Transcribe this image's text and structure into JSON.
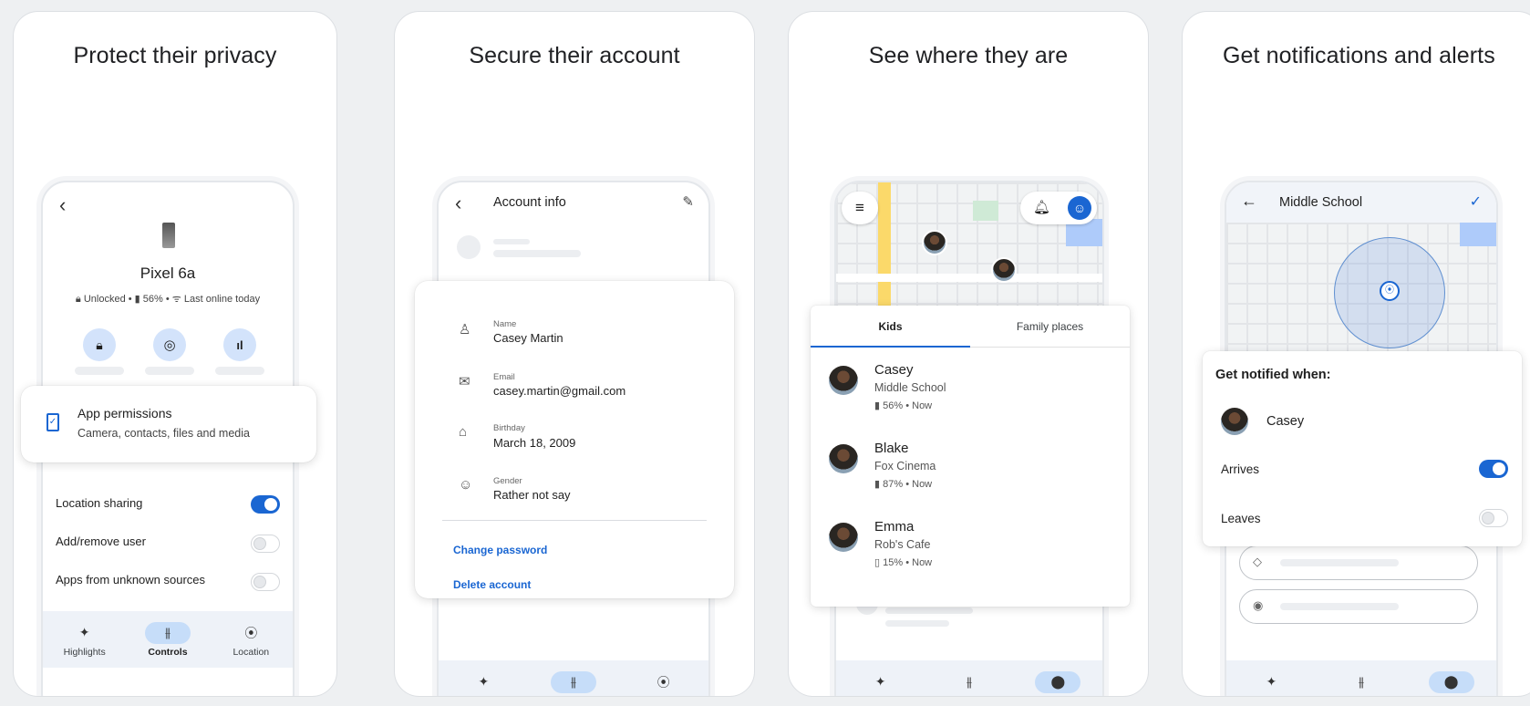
{
  "panels": [
    {
      "title": "Protect their privacy"
    },
    {
      "title": "Secure their account"
    },
    {
      "title": "See where they are"
    },
    {
      "title": "Get notifications and alerts"
    }
  ],
  "nav": [
    "Highlights",
    "Controls",
    "Location"
  ],
  "privacy": {
    "device_name": "Pixel 6a",
    "status_unlocked": "Unlocked",
    "status_battery": "56%",
    "status_online": "Last online today",
    "perm_title": "App permissions",
    "perm_sub": "Camera, contacts, files and media",
    "settings": [
      {
        "label": "Location sharing",
        "on": true
      },
      {
        "label": "Add/remove user",
        "on": false
      },
      {
        "label": "Apps from unknown sources",
        "on": false
      }
    ]
  },
  "account": {
    "header": "Account info",
    "fields": [
      {
        "label": "Name",
        "value": "Casey Martin"
      },
      {
        "label": "Email",
        "value": "casey.martin@gmail.com"
      },
      {
        "label": "Birthday",
        "value": "March 18, 2009"
      },
      {
        "label": "Gender",
        "value": "Rather not say"
      }
    ],
    "change_password": "Change password",
    "delete_account": "Delete account"
  },
  "where": {
    "tabs": [
      "Kids",
      "Family places"
    ],
    "people": [
      {
        "name": "Casey",
        "place": "Middle School",
        "battery": "56%",
        "time": "Now"
      },
      {
        "name": "Blake",
        "place": "Fox Cinema",
        "battery": "87%",
        "time": "Now"
      },
      {
        "name": "Emma",
        "place": "Rob's Cafe",
        "battery": "15%",
        "time": "Now"
      }
    ]
  },
  "notify": {
    "header": "Middle School",
    "title": "Get notified when:",
    "person": "Casey",
    "arrives": "Arrives",
    "leaves": "Leaves",
    "arrives_on": true,
    "leaves_on": false
  },
  "colors": {
    "accent": "#1a66d2",
    "link": "#1a66d2"
  }
}
